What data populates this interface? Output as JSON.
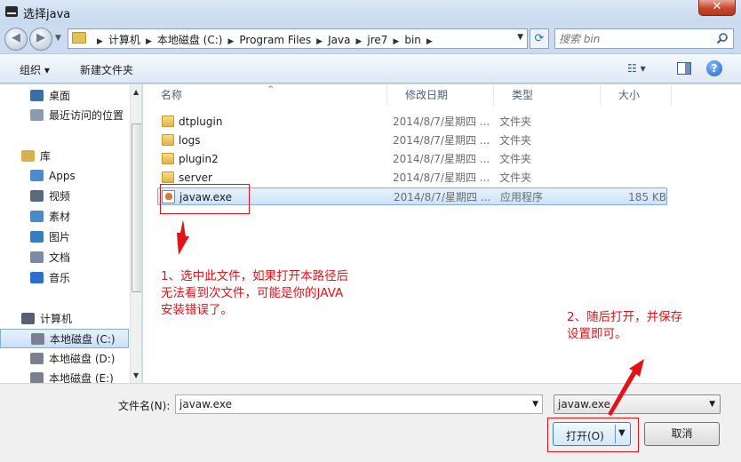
{
  "window": {
    "title": "选择java",
    "close_label": "✕"
  },
  "address": {
    "crumbs": [
      "计算机",
      "本地磁盘 (C:)",
      "Program Files",
      "Java",
      "jre7",
      "bin"
    ],
    "search_placeholder": "搜索 bin"
  },
  "toolbar": {
    "organize": "组织 ▾",
    "new_folder": "新建文件夹",
    "view_icon": "☷ ▾",
    "help": "?"
  },
  "nav": {
    "items": [
      {
        "label": "桌面",
        "icon": "desktop-icon"
      },
      {
        "label": "最近访问的位置",
        "icon": "recent-places-icon"
      },
      {
        "label": "库",
        "icon": "libraries-icon",
        "group": true
      },
      {
        "label": "Apps",
        "icon": "apps-library-icon"
      },
      {
        "label": "视频",
        "icon": "videos-icon"
      },
      {
        "label": "素材",
        "icon": "assets-library-icon"
      },
      {
        "label": "图片",
        "icon": "pictures-icon"
      },
      {
        "label": "文档",
        "icon": "documents-icon"
      },
      {
        "label": "音乐",
        "icon": "music-icon"
      },
      {
        "label": "计算机",
        "icon": "computer-icon",
        "group": true
      },
      {
        "label": "本地磁盘 (C:)",
        "icon": "drive-icon",
        "selected": true
      },
      {
        "label": "本地磁盘 (D:)",
        "icon": "drive-icon"
      },
      {
        "label": "本地磁盘 (E:)",
        "icon": "drive-icon"
      }
    ]
  },
  "columns": {
    "name": "名称",
    "date": "修改日期",
    "type": "类型",
    "size": "大小"
  },
  "files": [
    {
      "name": "dtplugin",
      "date": "2014/8/7/星期四 ...",
      "type": "文件夹",
      "size": "",
      "kind": "folder"
    },
    {
      "name": "logs",
      "date": "2014/8/7/星期四 ...",
      "type": "文件夹",
      "size": "",
      "kind": "folder"
    },
    {
      "name": "plugin2",
      "date": "2014/8/7/星期四 ...",
      "type": "文件夹",
      "size": "",
      "kind": "folder"
    },
    {
      "name": "server",
      "date": "2014/8/7/星期四 ...",
      "type": "文件夹",
      "size": "",
      "kind": "folder"
    },
    {
      "name": "javaw.exe",
      "date": "2014/8/7/星期四 ...",
      "type": "应用程序",
      "size": "185 KB",
      "kind": "exe",
      "selected": true
    }
  ],
  "bottom": {
    "filename_label": "文件名(N):",
    "filename_value": "javaw.exe",
    "filter_value": "javaw.exe",
    "open_label": "打开(O)",
    "cancel_label": "取消"
  },
  "annotations": {
    "note1": "1、选中此文件，如果打开本路径后\n无法看到次文件，可能是你的JAVA\n安装错误了。",
    "note2": "2、随后打开，并保存\n设置即可。",
    "color": "#e0121a"
  }
}
